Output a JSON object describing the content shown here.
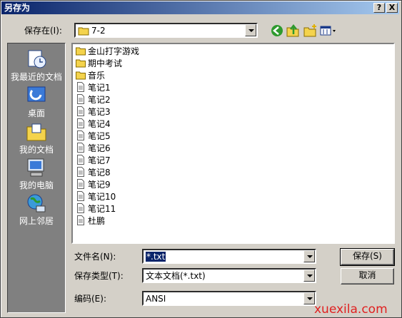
{
  "window": {
    "title": "另存为",
    "help_glyph": "?",
    "close_glyph": "X"
  },
  "toolbar": {
    "save_in_label": "保存在(I):",
    "save_in_value": "7-2"
  },
  "places": [
    {
      "label": "我最近的文档",
      "icon": "recent-documents-icon"
    },
    {
      "label": "桌面",
      "icon": "desktop-icon"
    },
    {
      "label": "我的文档",
      "icon": "my-documents-icon"
    },
    {
      "label": "我的电脑",
      "icon": "my-computer-icon"
    },
    {
      "label": "网上邻居",
      "icon": "network-places-icon"
    }
  ],
  "files": [
    {
      "name": "金山打字游戏",
      "type": "folder"
    },
    {
      "name": "期中考试",
      "type": "folder"
    },
    {
      "name": "音乐",
      "type": "folder"
    },
    {
      "name": "笔记1",
      "type": "text"
    },
    {
      "name": "笔记2",
      "type": "text"
    },
    {
      "name": "笔记3",
      "type": "text"
    },
    {
      "name": "笔记4",
      "type": "text"
    },
    {
      "name": "笔记5",
      "type": "text"
    },
    {
      "name": "笔记6",
      "type": "text"
    },
    {
      "name": "笔记7",
      "type": "text"
    },
    {
      "name": "笔记8",
      "type": "text"
    },
    {
      "name": "笔记9",
      "type": "text"
    },
    {
      "name": "笔记10",
      "type": "text"
    },
    {
      "name": "笔记11",
      "type": "text"
    },
    {
      "name": "杜鹏",
      "type": "text"
    }
  ],
  "form": {
    "filename_label": "文件名(N):",
    "filename_value": "*.txt",
    "filetype_label": "保存类型(T):",
    "filetype_value": "文本文档(*.txt)",
    "encoding_label": "编码(E):",
    "encoding_value": "ANSI"
  },
  "buttons": {
    "save": "保存(S)",
    "cancel": "取消"
  },
  "watermark": "xuexila.com",
  "colors": {
    "title_bar": "#0a246a",
    "dialog_bg": "#d4d0c8",
    "places_bar": "#808080",
    "folder": "#f4d34c",
    "back_arrow": "#2e9a2e",
    "watermark": "#e02020"
  }
}
